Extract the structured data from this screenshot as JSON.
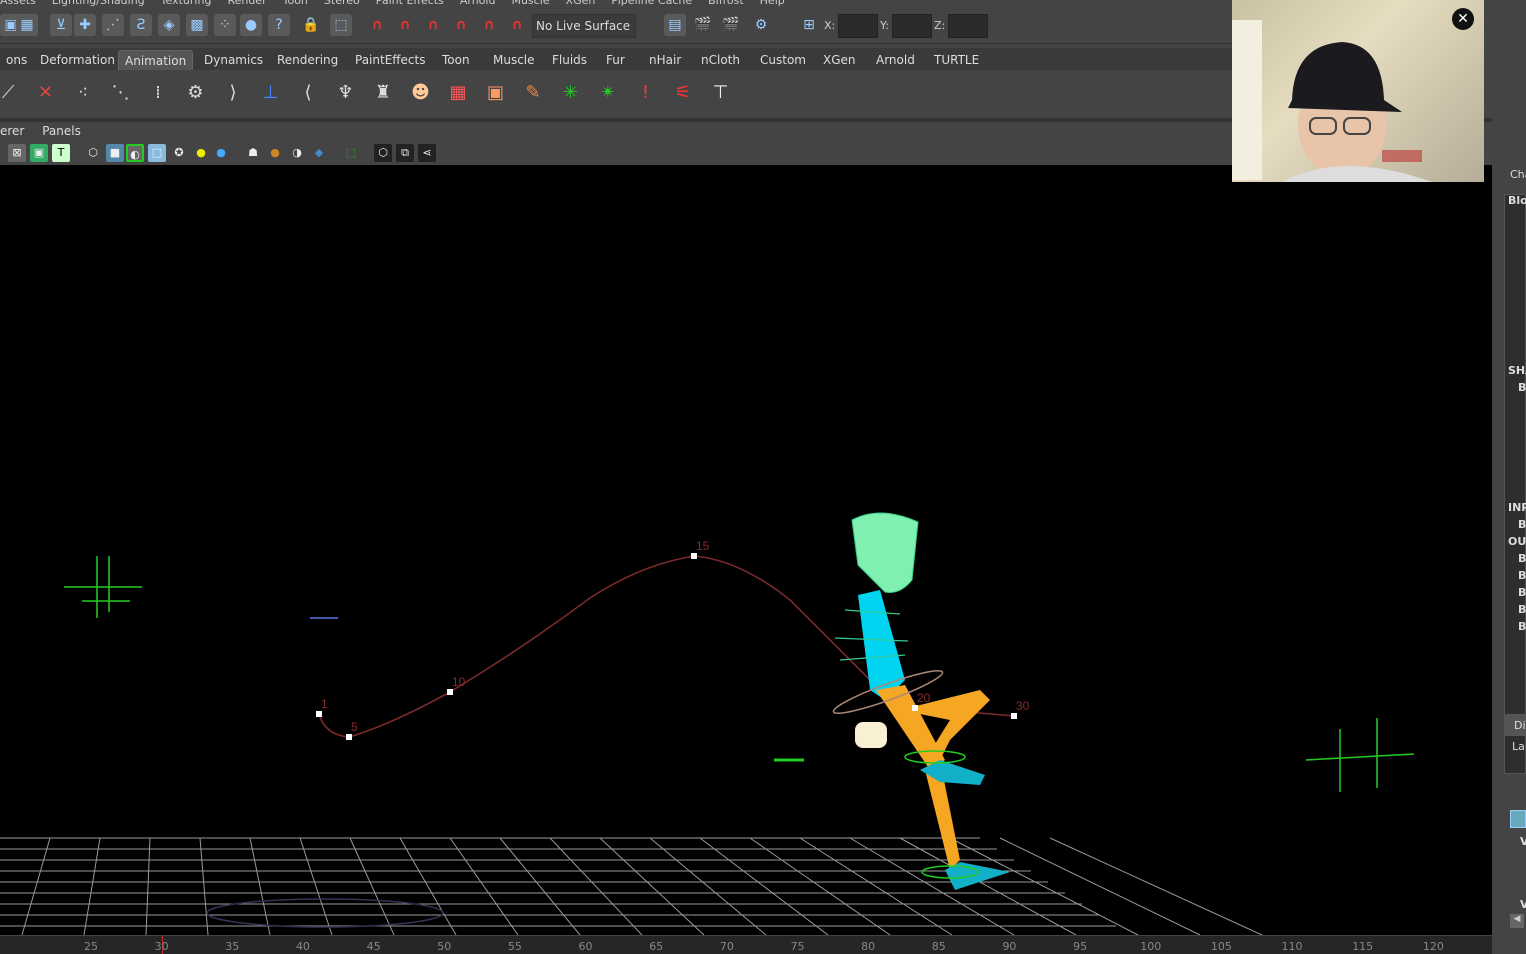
{
  "menubar": [
    "Assets",
    "Lighting/Shading",
    "Texturing",
    "Render",
    "Toon",
    "Stereo",
    "Paint Effects",
    "Arnold",
    "Muscle",
    "XGen",
    "Pipeline Cache",
    "Bifrost",
    "Help"
  ],
  "statusline": {
    "live_surface": "No Live Surface",
    "x_label": "X:",
    "y_label": "Y:",
    "z_label": "Z:",
    "x_value": "",
    "y_value": "",
    "z_value": ""
  },
  "shelf_tabs": [
    {
      "label": "ons"
    },
    {
      "label": "Deformation"
    },
    {
      "label": "Animation",
      "active": true
    },
    {
      "label": "Dynamics"
    },
    {
      "label": "Rendering"
    },
    {
      "label": "PaintEffects"
    },
    {
      "label": "Toon"
    },
    {
      "label": "Muscle"
    },
    {
      "label": "Fluids"
    },
    {
      "label": "Fur"
    },
    {
      "label": "nHair"
    },
    {
      "label": "nCloth"
    },
    {
      "label": "Custom"
    },
    {
      "label": "XGen"
    },
    {
      "label": "Arnold"
    },
    {
      "label": "TURTLE"
    }
  ],
  "panel_menu": {
    "renderer": "erer",
    "panels": "Panels"
  },
  "motion_path": {
    "color": "#7a2a2a",
    "frame_labels": [
      "1",
      "5",
      "10",
      "15",
      "20",
      "30"
    ]
  },
  "timeline": {
    "ticks": [
      "25",
      "30",
      "35",
      "40",
      "45",
      "50",
      "55",
      "60",
      "65",
      "70",
      "75",
      "80",
      "85",
      "90",
      "95",
      "100",
      "105",
      "110",
      "115",
      "120"
    ],
    "current_frame": 30,
    "current_color": "#c03030"
  },
  "channel_box": {
    "channels_label": "Cha",
    "blend_label": "Blo",
    "shapes_label": "SHA",
    "shape_item": "B",
    "inputs_label": "INP",
    "input_item": "B",
    "outputs_label": "OUT",
    "output_items": [
      "B",
      "B",
      "B",
      "B",
      "B"
    ],
    "display_label": "Dis",
    "layers_label": "La",
    "layer_items": [
      "V",
      "V"
    ]
  },
  "webcam": {
    "close_icon": "close-icon"
  },
  "colors": {
    "accent_tab": "#555555",
    "viewport_bg": "#000000",
    "grid": "#9a9a9a",
    "skin_orange": "#f5a623",
    "cyan": "#00d4f0",
    "mesh_green": "#7ff0b0"
  }
}
